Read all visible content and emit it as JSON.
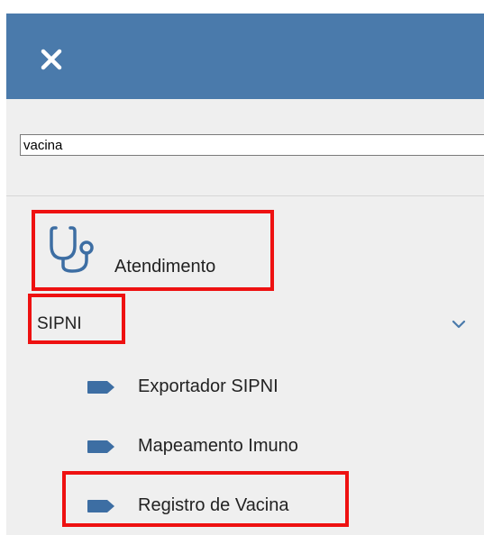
{
  "header": {
    "close_icon": "close-icon",
    "background_color": "#4a7aab"
  },
  "search": {
    "value": "vacina"
  },
  "menu": {
    "atendimento": {
      "icon": "stethoscope-icon",
      "label": "Atendimento"
    },
    "sipni": {
      "label": "SIPNI",
      "expand_icon": "chevron-down-icon",
      "items": [
        {
          "label": "Exportador SIPNI",
          "icon": "tag-icon"
        },
        {
          "label": "Mapeamento Imuno",
          "icon": "tag-icon"
        },
        {
          "label": "Registro de Vacina",
          "icon": "tag-icon"
        }
      ]
    }
  },
  "colors": {
    "accent": "#4a7aab",
    "highlight": "#ee1111",
    "tag_icon": "#3d6ea3",
    "panel_background": "#efefef"
  }
}
